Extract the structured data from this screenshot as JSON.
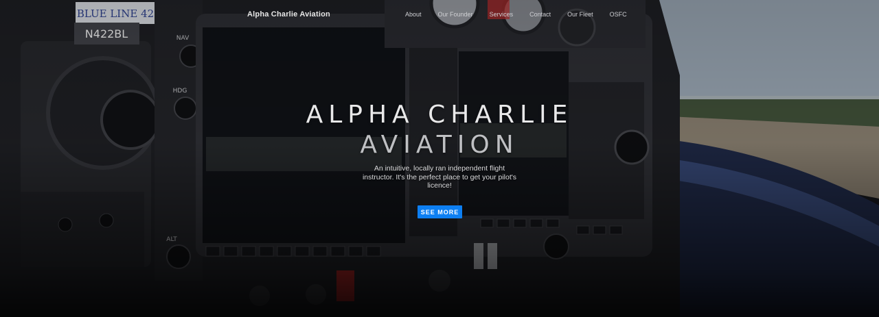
{
  "header": {
    "brand": "Alpha Charlie Aviation",
    "nav": [
      {
        "label": "About"
      },
      {
        "label": "Our Founder"
      },
      {
        "label": "Services"
      },
      {
        "label": "Contact"
      },
      {
        "label": "Our Fleet"
      },
      {
        "label": "OSFC"
      }
    ]
  },
  "hero": {
    "title_line1": "ALPHA CHARLIE",
    "title_line2": "AVIATION",
    "subtitle": "An intuitive, locally ran independent flight instructor. It's the perfect place to get your pilot's licence!",
    "cta_label": "SEE MORE",
    "background_image": "aircraft cockpit instrument panel",
    "panel_labels": {
      "placard_top": "BLUE LINE 42",
      "tail_number": "N422BL",
      "nav_label": "NAV",
      "hdg_label": "HDG",
      "alt_label": "ALT"
    }
  },
  "colors": {
    "accent": "#0d7ff2",
    "text": "#e9e9ea",
    "background": "#15161b"
  }
}
